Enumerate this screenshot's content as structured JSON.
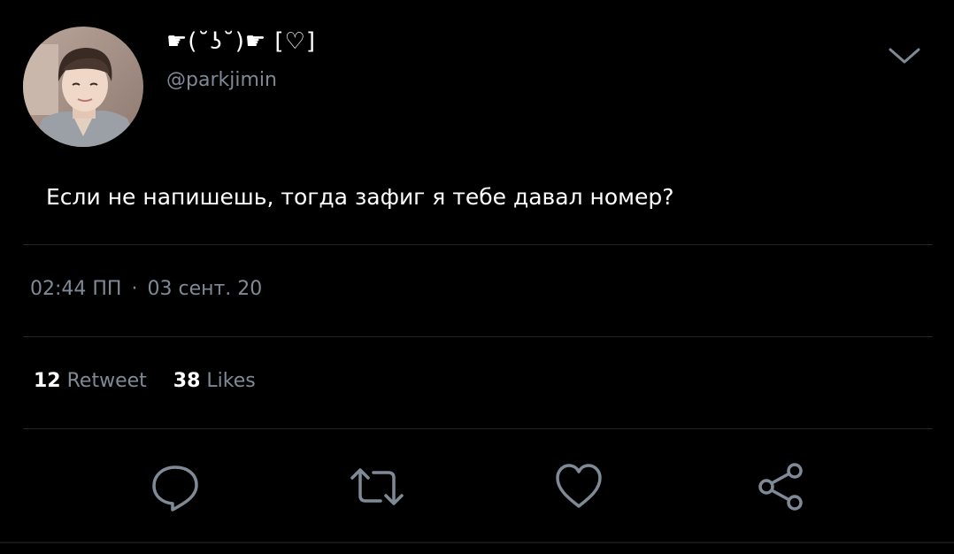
{
  "header": {
    "display_name": "☛(˘ʖ˘)☛ [♡]",
    "handle": "@parkjimin"
  },
  "tweet": {
    "text": "Если не напишешь, тогда зафиг я тебе давал номер?",
    "time": "02:44 ПП",
    "separator": "·",
    "date": "03 сент. 20"
  },
  "stats": {
    "retweets_count": "12",
    "retweets_label": "Retweet",
    "likes_count": "38",
    "likes_label": "Likes"
  },
  "icons": {
    "menu": "chevron-down-icon",
    "reply": "reply-icon",
    "retweet": "retweet-icon",
    "like": "heart-icon",
    "share": "share-icon"
  },
  "colors": {
    "background": "#000000",
    "primary_text": "#ffffff",
    "secondary_text": "#7f8a96",
    "divider": "#222528"
  }
}
